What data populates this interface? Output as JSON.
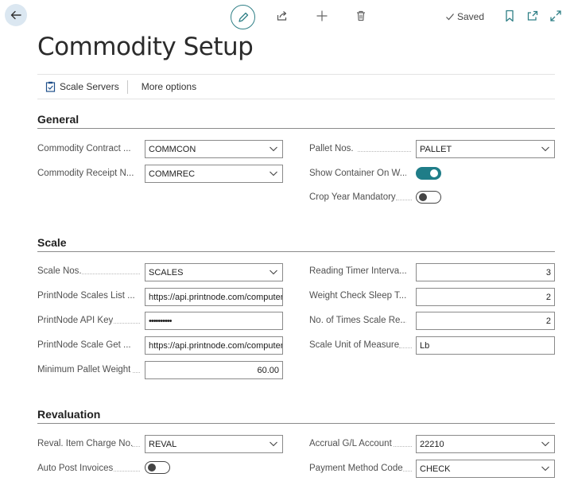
{
  "page": {
    "title": "Commodity Setup"
  },
  "toolbar": {
    "saved_label": "Saved"
  },
  "actions": {
    "scale_servers": "Scale Servers",
    "more_options": "More options"
  },
  "sections": {
    "general": {
      "title": "General",
      "commodity_contract_label": "Commodity Contract ...",
      "commodity_contract_value": "COMMCON",
      "commodity_receipt_label": "Commodity Receipt N...",
      "commodity_receipt_value": "COMMREC",
      "pallet_nos_label": "Pallet Nos.",
      "pallet_nos_value": "PALLET",
      "show_container_label": "Show Container On W...",
      "show_container_on": true,
      "crop_year_label": "Crop Year Mandatory",
      "crop_year_on": false
    },
    "scale": {
      "title": "Scale",
      "scale_nos_label": "Scale Nos.",
      "scale_nos_value": "SCALES",
      "printnode_list_label": "PrintNode Scales List ...",
      "printnode_list_value": "https://api.printnode.com/computers",
      "printnode_key_label": "PrintNode API Key",
      "printnode_key_value": "••••••••••",
      "printnode_get_label": "PrintNode Scale Get ...",
      "printnode_get_value": "https://api.printnode.com/computers",
      "min_pallet_label": "Minimum Pallet Weight",
      "min_pallet_value": "60.00",
      "reading_timer_label": "Reading Timer Interva...",
      "reading_timer_value": "3",
      "weight_check_label": "Weight Check Sleep T...",
      "weight_check_value": "2",
      "times_scale_label": "No. of Times Scale Re...",
      "times_scale_value": "2",
      "scale_uom_label": "Scale Unit of Measure",
      "scale_uom_value": "Lb"
    },
    "revaluation": {
      "title": "Revaluation",
      "reval_charge_label": "Reval. Item Charge No.",
      "reval_charge_value": "REVAL",
      "auto_post_label": "Auto Post Invoices",
      "auto_post_on": false,
      "accrual_label": "Accrual G/L Account",
      "accrual_value": "22210",
      "payment_method_label": "Payment Method Code",
      "payment_method_value": "CHECK"
    }
  },
  "colors": {
    "accent": "#1f7d88",
    "back_bg": "#dbe7f1"
  }
}
